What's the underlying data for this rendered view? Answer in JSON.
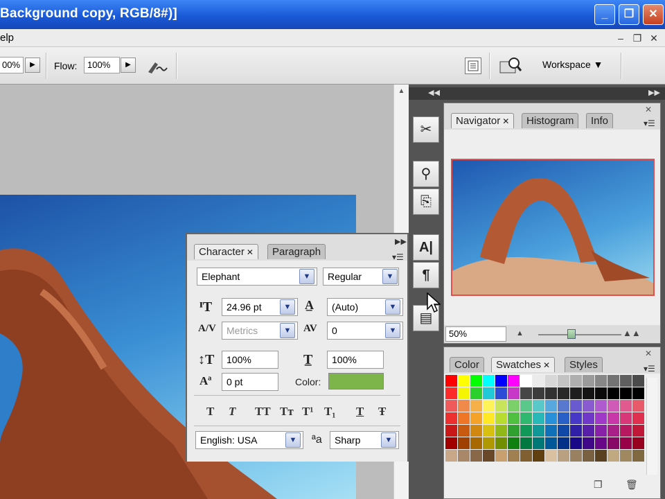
{
  "window": {
    "title": "Background copy, RGB/8#)]",
    "min_icon": "minimize-icon",
    "max_icon": "maximize-icon",
    "close_icon": "close-icon",
    "min_glyph": "_",
    "max_glyph": "❐",
    "close_glyph": "✕"
  },
  "menubar": {
    "help_label": "elp",
    "doc_min_glyph": "–",
    "doc_max_glyph": "❐",
    "doc_close_glyph": "✕"
  },
  "options": {
    "opacity_value": "00%",
    "flow_label": "Flow:",
    "flow_value": "100%",
    "airbrush_icon": "airbrush-icon",
    "palette_icon": "palette-well-icon",
    "bridge_icon": "go-to-bridge-icon",
    "workspace_label": "Workspace ▼"
  },
  "dock_icons": {
    "tool_presets": "tool-presets-icon",
    "brushes": "brushes-icon",
    "clone_source": "clone-source-icon",
    "character": "character-icon",
    "paragraph": "paragraph-icon",
    "layer_comps": "layer-comps-icon"
  },
  "navigator": {
    "tabs": [
      "Navigator",
      "Histogram",
      "Info"
    ],
    "zoom": "50%"
  },
  "character_panel": {
    "tabs": [
      "Character",
      "Paragraph"
    ],
    "font_family": "Elephant",
    "font_style": "Regular",
    "font_size": "24.96 pt",
    "leading": "(Auto)",
    "kerning": "Metrics",
    "tracking": "0",
    "vertical_scale": "100%",
    "horizontal_scale": "100%",
    "baseline_shift": "0 pt",
    "color_label": "Color:",
    "color_value": "#7db54a",
    "language": "English: USA",
    "aa_label": "ªa",
    "antialias": "Sharp",
    "style_buttons": [
      "T",
      "T",
      "TT",
      "Tт",
      "T¹",
      "T₁",
      "T",
      "Ŧ"
    ]
  },
  "color_panel": {
    "tabs": [
      "Color",
      "Swatches",
      "Styles"
    ],
    "swatch_rows": [
      [
        "#ff0000",
        "#ffff00",
        "#00ff00",
        "#00ffff",
        "#0000ff",
        "#ff00ff",
        "#ffffff",
        "#ebebeb",
        "#d7d7d7",
        "#c3c3c3",
        "#afafaf",
        "#9b9b9b",
        "#878787",
        "#737373",
        "#5f5f5f",
        "#4b4b4b"
      ],
      [
        "#ff2a2a",
        "#f5f500",
        "#2cd02c",
        "#20c8d8",
        "#2c4cd8",
        "#c838c8",
        "#464646",
        "#3c3c3c",
        "#323232",
        "#282828",
        "#1e1e1e",
        "#141414",
        "#0a0a0a",
        "#000000",
        "#000000",
        "#000000"
      ],
      [
        "#ef5b5b",
        "#f08a4a",
        "#f5b04a",
        "#fff35a",
        "#c8e45a",
        "#7cd06a",
        "#5ac88a",
        "#58c8c8",
        "#58a8e0",
        "#5878d0",
        "#6a5ad0",
        "#8a5ad0",
        "#b05ad0",
        "#d05ab8",
        "#e05a90",
        "#e85a6a"
      ],
      [
        "#ec2f2f",
        "#ef7626",
        "#f5a328",
        "#ffe826",
        "#b8dc30",
        "#50c040",
        "#30b870",
        "#28b8b8",
        "#2890d8",
        "#2860c8",
        "#4838c8",
        "#7038c8",
        "#a038c8",
        "#c838a8",
        "#d83878",
        "#e03050"
      ],
      [
        "#c81818",
        "#c85a10",
        "#d08810",
        "#d8c010",
        "#90b818",
        "#30a030",
        "#109858",
        "#109898",
        "#1070b8",
        "#1048a8",
        "#3020a8",
        "#5820a8",
        "#8820a8",
        "#a82088",
        "#b81860",
        "#c01838"
      ],
      [
        "#a00000",
        "#a04000",
        "#a86800",
        "#b09800",
        "#708f00",
        "#108010",
        "#007840",
        "#007878",
        "#005898",
        "#003088",
        "#180888",
        "#400888",
        "#680888",
        "#880868",
        "#980048",
        "#980020"
      ],
      [
        "#c8a888",
        "#a88868",
        "#886848",
        "#684828",
        "#c8a070",
        "#a08050",
        "#806030",
        "#604010",
        "#d8c0a0",
        "#b8a080",
        "#988060",
        "#786040",
        "#584020",
        "#c0a880",
        "#a08860",
        "#806840"
      ]
    ]
  }
}
